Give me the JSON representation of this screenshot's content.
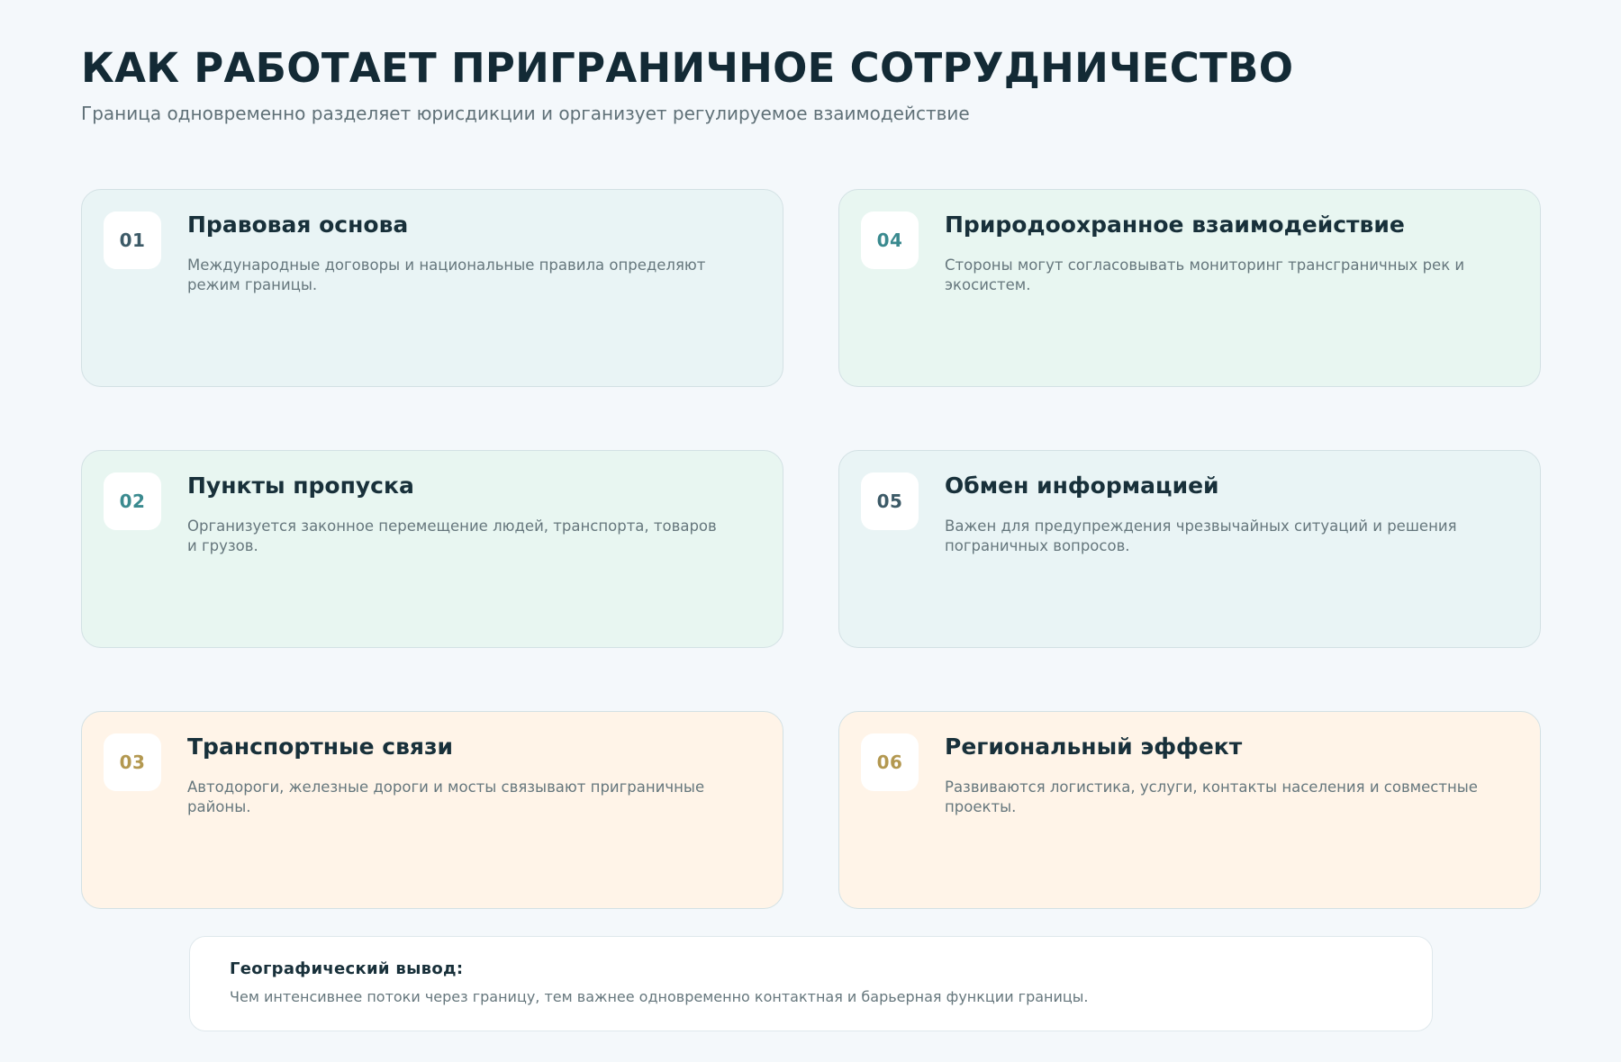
{
  "header": {
    "title": "КАК РАБОТАЕТ ПРИГРАНИЧНОЕ СОТРУДНИЧЕСТВО",
    "subtitle": "Граница одновременно разделяет юрисдикции и организует регулируемое взаимодействие"
  },
  "colors": {
    "background": "#f4f8fb",
    "title": "#132a35",
    "card_teal": "#e9f4f5",
    "card_green": "#e8f6f1",
    "card_amber": "#fff4e8",
    "number_slate": "#3c5a67",
    "number_teal": "#3a8a8f",
    "number_gold": "#b39850"
  },
  "cards": [
    {
      "number": "01",
      "title": "Правовая основа",
      "text": "Международные договоры и национальные правила определяют режим границы.",
      "tone": "teal",
      "number_color": "#3c5a67"
    },
    {
      "number": "02",
      "title": "Пункты пропуска",
      "text": "Организуется законное перемещение людей, транспорта, товаров и грузов.",
      "tone": "green",
      "number_color": "#3a8a8f"
    },
    {
      "number": "03",
      "title": "Транспортные связи",
      "text": "Автодороги, железные дороги и мосты связывают приграничные районы.",
      "tone": "amber",
      "number_color": "#b39850"
    },
    {
      "number": "04",
      "title": "Природоохранное взаимодействие",
      "text": "Стороны могут согласовывать мониторинг трансграничных рек и экосистем.",
      "tone": "green",
      "number_color": "#3a8a8f"
    },
    {
      "number": "05",
      "title": "Обмен информацией",
      "text": "Важен для предупреждения чрезвычайных ситуаций и решения пограничных вопросов.",
      "tone": "teal",
      "number_color": "#3c5a67"
    },
    {
      "number": "06",
      "title": "Региональный эффект",
      "text": "Развиваются логистика, услуги, контакты населения и совместные проекты.",
      "tone": "amber",
      "number_color": "#b39850"
    }
  ],
  "conclusion": {
    "title": "Географический вывод:",
    "text": "Чем интенсивнее потоки через границу, тем важнее одновременно контактная и барьерная функции границы."
  }
}
